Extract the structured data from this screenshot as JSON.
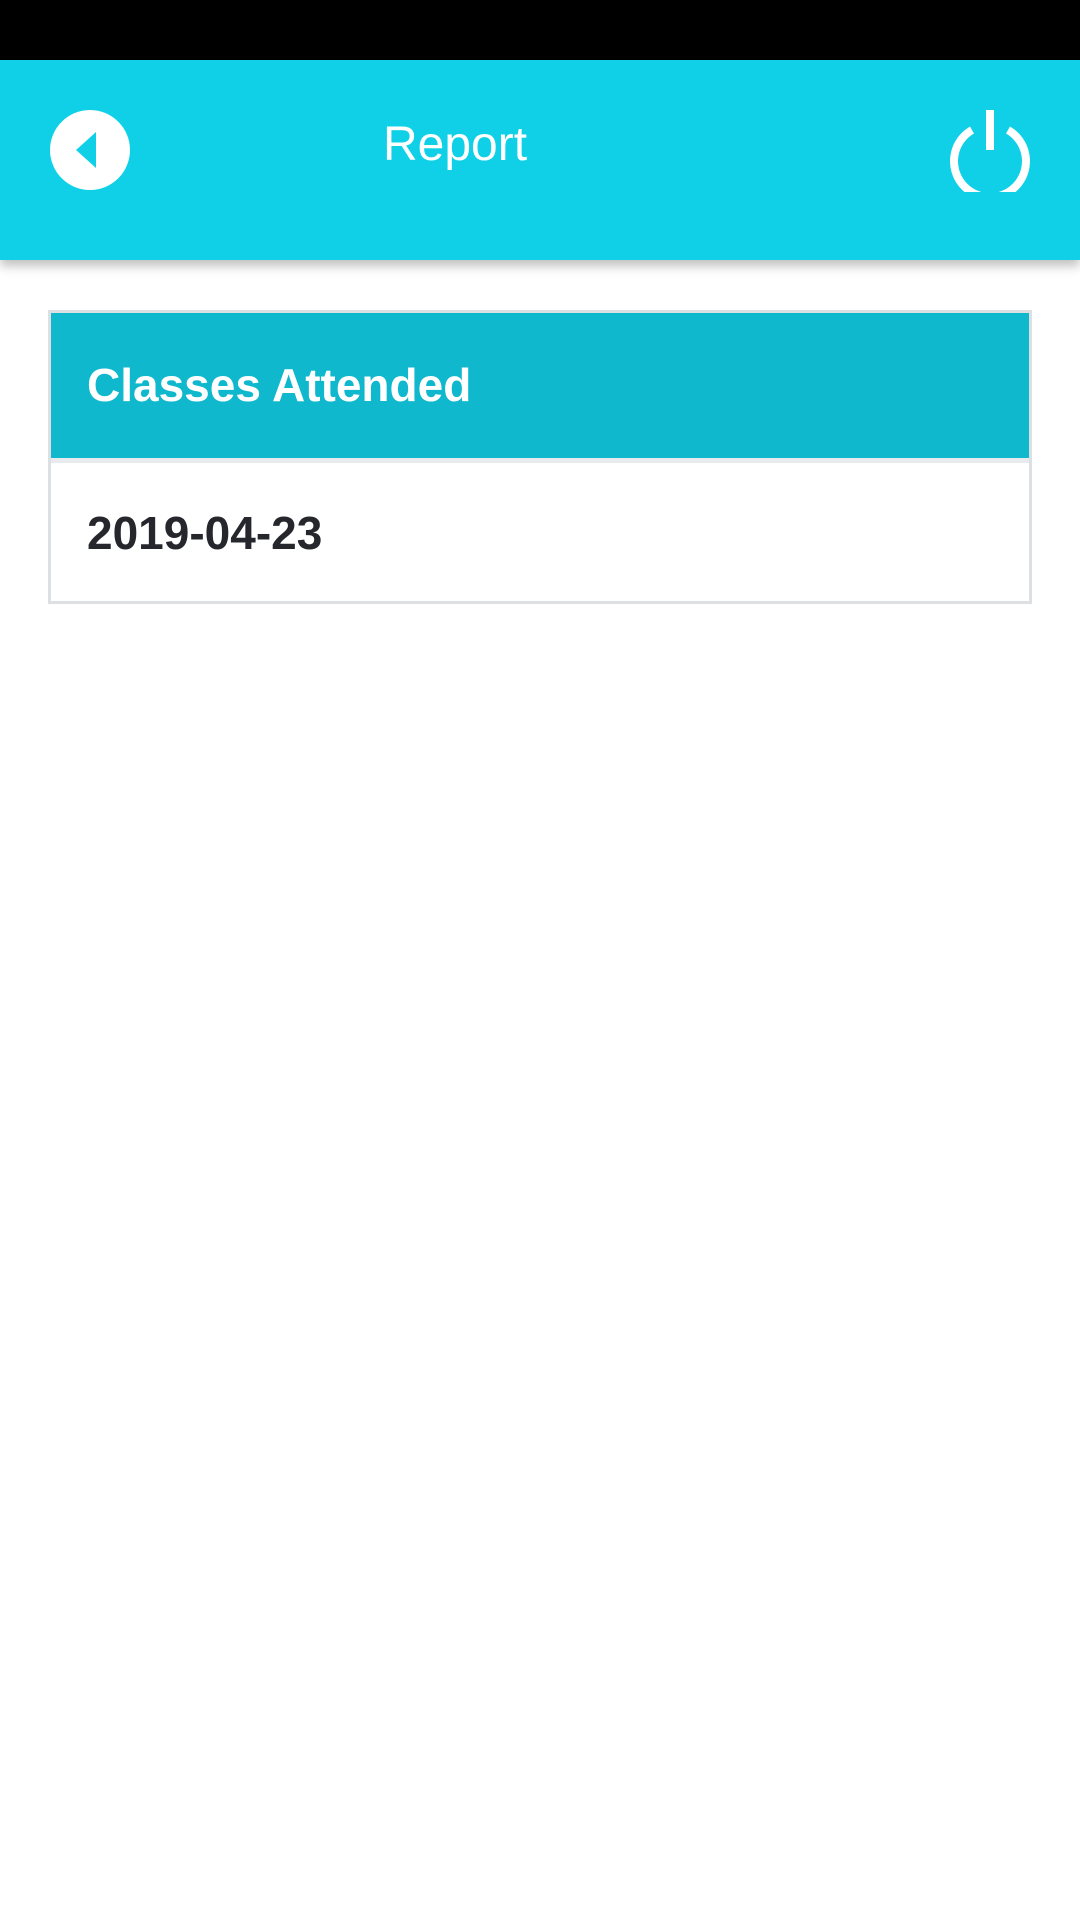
{
  "header": {
    "title": "Report",
    "back_icon": "back-arrow-icon",
    "power_icon": "power-icon"
  },
  "report": {
    "section_title": "Classes Attended",
    "dates": [
      "2019-04-23"
    ]
  },
  "colors": {
    "app_bar": "#10d0e8",
    "card_header": "#0fb8cd",
    "status_bar": "#000000"
  }
}
